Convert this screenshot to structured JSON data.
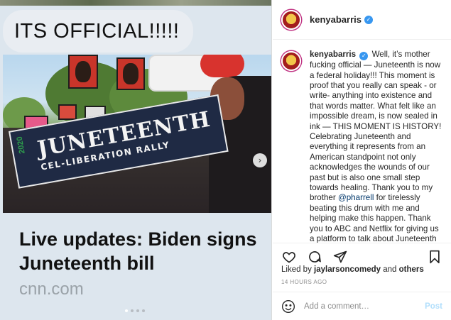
{
  "post": {
    "overlay_text": "ITS OFFICIAL!!!!!",
    "banner_title": "JUNETEENTH",
    "banner_subtitle": "CEL-LIBERATION RALLY",
    "banner_year": "2020",
    "card_title": "Live updates: Biden signs Juneteenth bill",
    "card_source": "cnn.com",
    "next_arrow": "›",
    "carousel_dots": 4,
    "carousel_active": 1
  },
  "header": {
    "username": "kenyabarris",
    "verified": "✓"
  },
  "caption": {
    "username": "kenyabarris",
    "text_before_mention": "Well, it’s mother fucking official — Juneteenth is now a federal holiday!!! This moment is proof that you really can speak - or write- anything into existence and that words matter. What felt like an impossible dream, is now sealed in ink — THIS MOMENT IS HISTORY! Celebrating Juneteenth and everything it represents from an American standpoint not only acknowledges the wounds of our past but is also one small step towards healing. Thank you to my brother",
    "mention": "@pharrell",
    "text_after_mention": "for tirelessly beating this drum with me and helping make this happen. Thank you to ABC and Netflix for giving us a platform to talk about Juneteenth—more than once! To all the internet trolls, “woke” cancel culture warriors and Twitter experts"
  },
  "engagement": {
    "liked_by_prefix": "Liked by",
    "liked_by_user": "jaylarsoncomedy",
    "and_text": "and",
    "others": "others",
    "timestamp": "14 HOURS AGO"
  },
  "comment_box": {
    "placeholder": "Add a comment…",
    "post_label": "Post"
  },
  "colors": {
    "verified_blue": "#3897f0",
    "mention_blue": "#00376b",
    "post_disabled": "#b2dffc",
    "card_bg": "#dde6ee"
  },
  "icons": [
    "heart-icon",
    "comment-icon",
    "share-icon",
    "bookmark-icon",
    "emoji-icon",
    "verified-badge-icon",
    "chevron-right-icon"
  ]
}
